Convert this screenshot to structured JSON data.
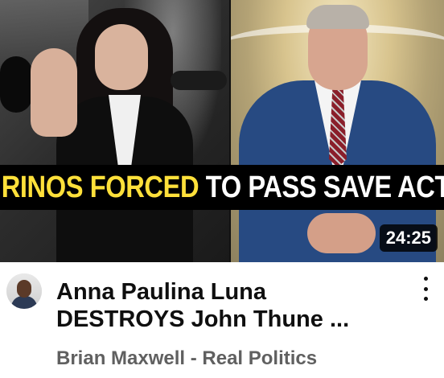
{
  "video": {
    "banner": {
      "yellow_text": "RINOS FORCED",
      "white_text": " TO PASS SAVE ACT",
      "yellow_suffix": "???"
    },
    "duration": "24:25",
    "title_line1": "Anna Paulina Luna",
    "title_line2": "DESTROYS John Thune ...",
    "channel": "Brian Maxwell - Real Politics",
    "menu_icon": "vertical-ellipsis-icon"
  },
  "colors": {
    "banner_yellow": "#ffe03a",
    "banner_white": "#ffffff",
    "banner_bg": "#000000",
    "title": "#0f0f0f",
    "channel": "#606060"
  }
}
